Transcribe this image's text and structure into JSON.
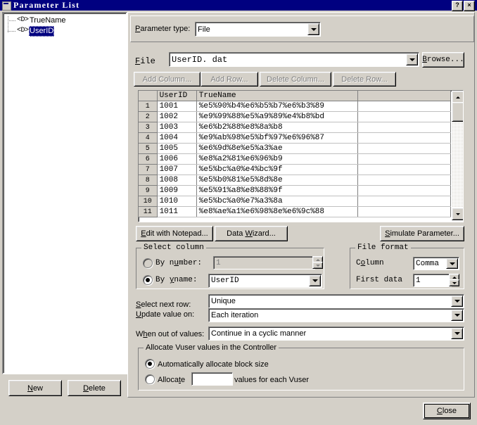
{
  "window": {
    "title": "Parameter List",
    "icon": "parameter-list-icon",
    "help_button": "?",
    "close_button": "×"
  },
  "tree": {
    "items": [
      {
        "label": "TrueName",
        "icon": "<D>",
        "selected": false
      },
      {
        "label": "UserID",
        "icon": "<D>",
        "selected": true
      }
    ]
  },
  "left_buttons": {
    "new": "New",
    "delete": "Delete"
  },
  "parameter_type": {
    "label": "Parameter type:",
    "value": "File"
  },
  "file_row": {
    "label": "File",
    "value": "UserID. dat",
    "browse": "Browse..."
  },
  "table_buttons": {
    "add_column": "Add Column...",
    "add_row": "Add Row...",
    "delete_column": "Delete Column...",
    "delete_row": "Delete Row..."
  },
  "grid": {
    "columns": [
      "",
      "UserID",
      "TrueName",
      ""
    ],
    "rows": [
      {
        "n": "1",
        "UserID": "1001",
        "TrueName": "%e5%90%b4%e6%b5%b7%e6%b3%89"
      },
      {
        "n": "2",
        "UserID": "1002",
        "TrueName": "%e9%99%88%e5%a9%89%e4%b8%bd"
      },
      {
        "n": "3",
        "UserID": "1003",
        "TrueName": "%e6%b2%88%e8%8a%b8"
      },
      {
        "n": "4",
        "UserID": "1004",
        "TrueName": "%e9%ab%98%e5%bf%97%e6%96%87"
      },
      {
        "n": "5",
        "UserID": "1005",
        "TrueName": "%e6%9d%8e%e5%a3%ae"
      },
      {
        "n": "6",
        "UserID": "1006",
        "TrueName": "%e8%a2%81%e6%96%b9"
      },
      {
        "n": "7",
        "UserID": "1007",
        "TrueName": "%e5%bc%a0%e4%bc%9f"
      },
      {
        "n": "8",
        "UserID": "1008",
        "TrueName": "%e5%b0%81%e5%8d%8e"
      },
      {
        "n": "9",
        "UserID": "1009",
        "TrueName": "%e5%91%a8%e8%88%9f"
      },
      {
        "n": "10",
        "UserID": "1010",
        "TrueName": "%e5%bc%a0%e7%a3%8a"
      },
      {
        "n": "11",
        "UserID": "1011",
        "TrueName": "%e8%ae%a1%e6%98%8e%e6%9c%88"
      }
    ]
  },
  "action_buttons": {
    "edit_notepad": "Edit with Notepad...",
    "data_wizard": "Data Wizard...",
    "simulate_parameter": "Simulate Parameter..."
  },
  "select_column": {
    "legend": "Select column",
    "by_number_label": "By number:",
    "by_number_value": "1",
    "by_number_selected": false,
    "by_name_label": "By name:",
    "by_name_value": "UserID",
    "by_name_selected": true
  },
  "file_format": {
    "legend": "File format",
    "column_label": "Column",
    "column_value": "Comma",
    "first_data_label": "First data",
    "first_data_value": "1"
  },
  "row_options": {
    "select_next_row_label": "Select next row:",
    "select_next_row_value": "Unique",
    "update_value_on_label": "Update value on:",
    "update_value_on_value": "Each iteration",
    "when_out_of_values_label": "When out of values:",
    "when_out_of_values_value": "Continue in a cyclic manner"
  },
  "allocate": {
    "legend": "Allocate Vuser values in the Controller",
    "auto_label": "Automatically allocate block size",
    "auto_selected": true,
    "manual_label": "Allocate",
    "manual_value": "",
    "manual_suffix": "values for each Vuser",
    "manual_selected": false
  },
  "footer": {
    "close": "Close"
  }
}
